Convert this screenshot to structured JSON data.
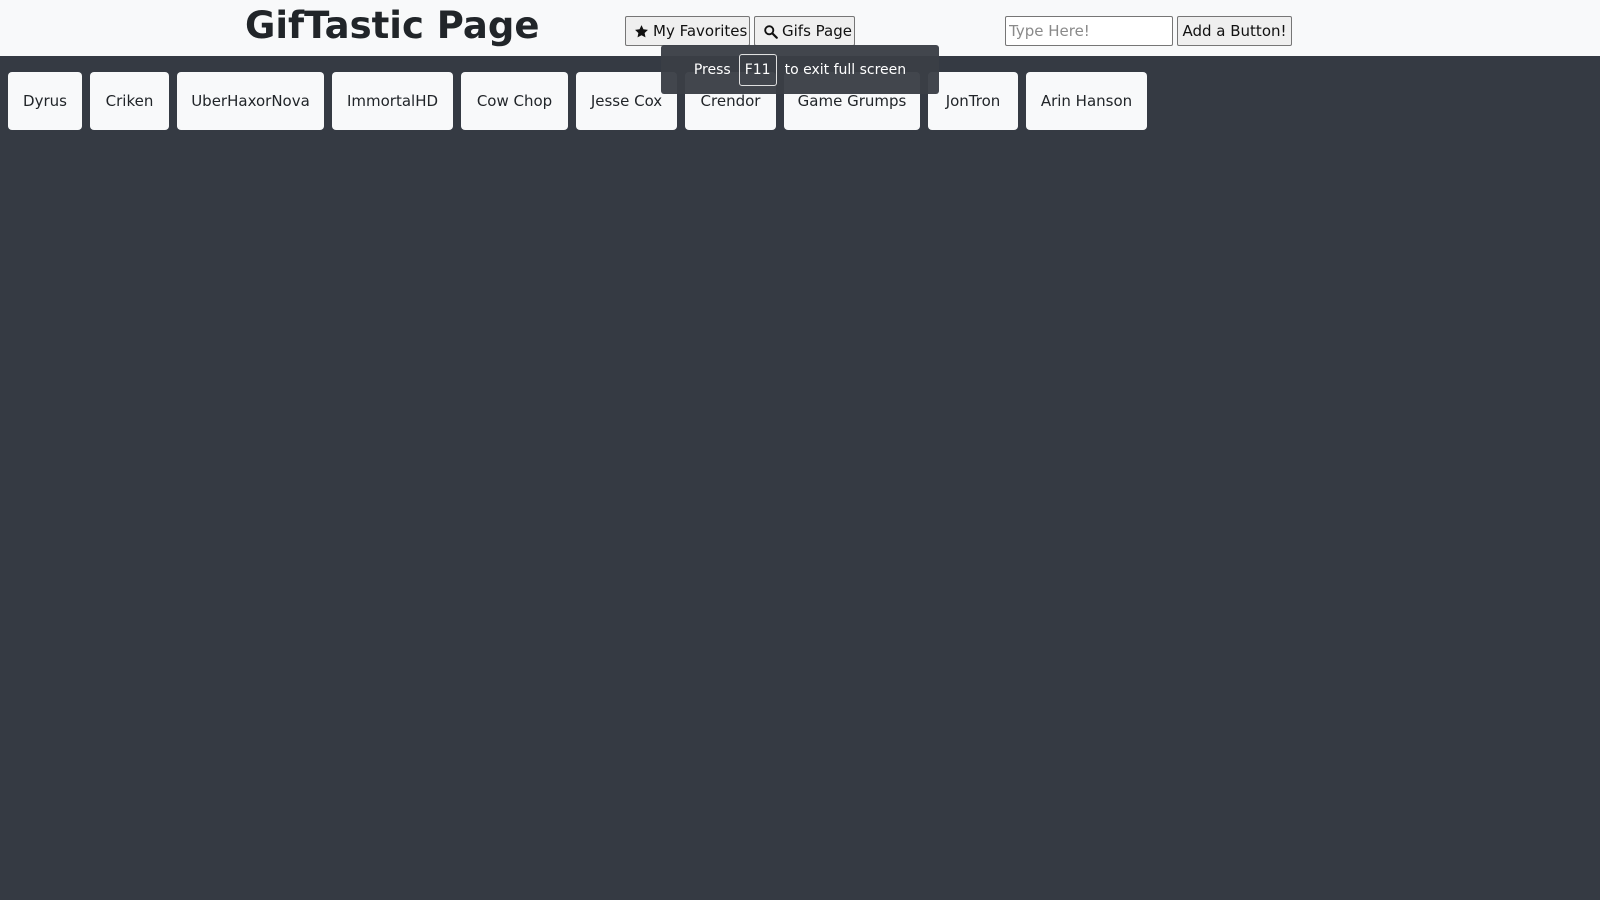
{
  "header": {
    "title": "GifTastic Page",
    "favorites_label": "My Favorites",
    "favorites_icon": "star-icon",
    "gifs_label": "Gifs Page",
    "gifs_icon": "search-icon",
    "input_placeholder": "Type Here!",
    "input_value": "",
    "add_label": "Add a Button!"
  },
  "topics": [
    "Dyrus",
    "Criken",
    "UberHaxorNova",
    "ImmortalHD",
    "Cow Chop",
    "Jesse Cox",
    "Crendor",
    "Game Grumps",
    "JonTron",
    "Arin Hanson"
  ],
  "fullscreen_notice": {
    "prefix": "Press",
    "key": "F11",
    "suffix": "to exit full screen"
  },
  "colors": {
    "background": "#353a43",
    "navbar": "#f8f9fa",
    "topic_button": "#f8f9fa"
  }
}
